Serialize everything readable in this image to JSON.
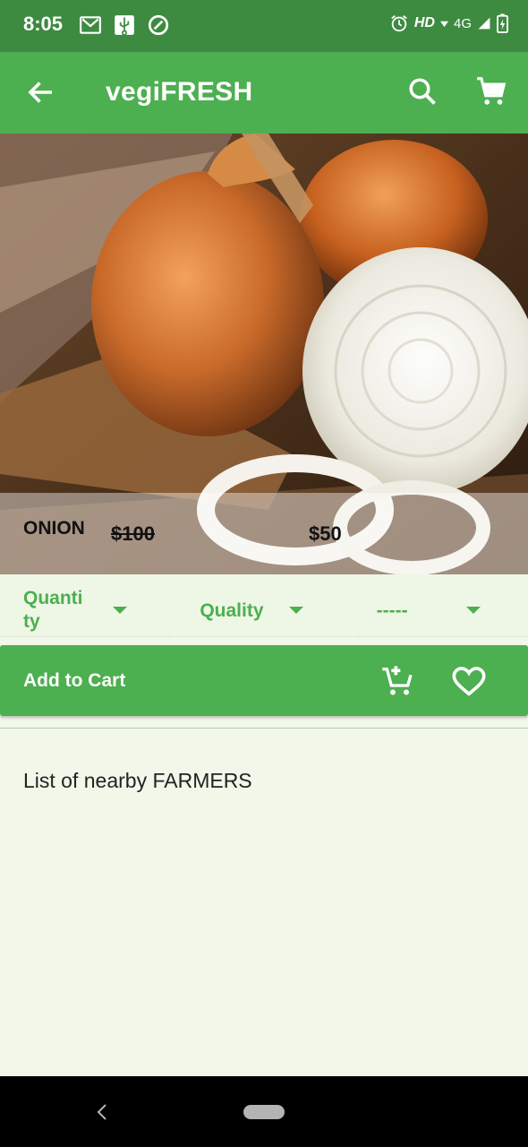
{
  "status_bar": {
    "time": "8:05",
    "left_icons": [
      "gmail-icon",
      "usb-icon",
      "data-saver-icon"
    ],
    "hd_label": "HD",
    "network_label": "4G",
    "right_icons": [
      "alarm-icon",
      "wifi-icon",
      "signal-icon",
      "battery-charging-icon"
    ]
  },
  "app_bar": {
    "title": "vegiFRESH",
    "back_icon": "arrow-back-icon",
    "search_icon": "search-icon",
    "cart_icon": "shopping-cart-icon"
  },
  "product": {
    "name": "ONION",
    "old_price": "$100",
    "new_price": "$50"
  },
  "dropdowns": [
    {
      "label": "Quanti ty"
    },
    {
      "label": "Quality"
    },
    {
      "label": "-----"
    }
  ],
  "cart_bar": {
    "label": "Add to Cart",
    "add_icon": "add-shopping-cart-icon",
    "fav_icon": "heart-outline-icon"
  },
  "farmers": {
    "heading": "List of nearby FARMERS"
  },
  "colors": {
    "status_bar": "#3d8b40",
    "primary": "#4caf50",
    "background": "#f1f8e9"
  }
}
